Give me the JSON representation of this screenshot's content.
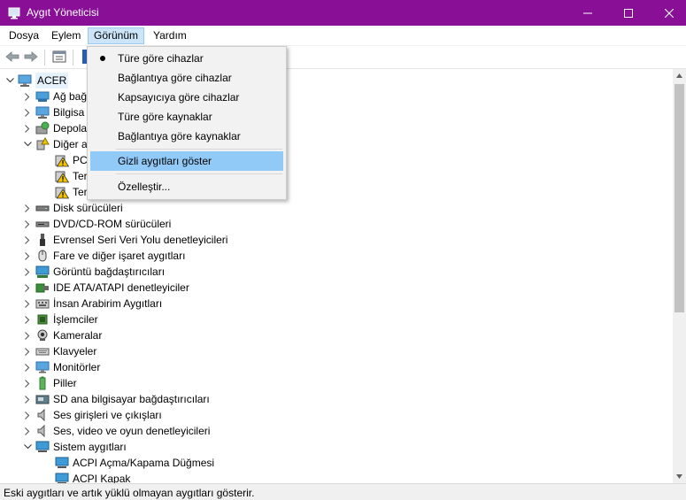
{
  "window": {
    "title": "Aygıt Yöneticisi"
  },
  "menubar": [
    "Dosya",
    "Eylem",
    "Görünüm",
    "Yardım"
  ],
  "view_menu": {
    "items": [
      {
        "label": "Türe göre cihazlar",
        "selected": true
      },
      {
        "label": "Bağlantıya göre cihazlar"
      },
      {
        "label": "Kapsayıcıya göre cihazlar"
      },
      {
        "label": "Türe göre kaynaklar"
      },
      {
        "label": "Bağlantıya göre kaynaklar"
      },
      {
        "label": "Gizli aygıtları göster",
        "highlighted": true
      },
      {
        "label": "Özelleştir..."
      }
    ]
  },
  "tree": {
    "root": "ACER",
    "nodes": [
      {
        "label": "Ağ bağ",
        "icon": "network-adapter-icon",
        "expanded": false
      },
      {
        "label": "Bilgisa",
        "icon": "computer-icon",
        "expanded": false
      },
      {
        "label": "Depola",
        "icon": "storage-controller-icon",
        "expanded": false
      },
      {
        "label": "Diğer a",
        "icon": "other-devices-icon",
        "expanded": true
      },
      {
        "label": "PC",
        "icon": "warning-device-icon",
        "child": true
      },
      {
        "label": "Ter",
        "icon": "warning-device-icon",
        "child": true
      },
      {
        "label": "Ter",
        "icon": "warning-device-icon",
        "child": true
      },
      {
        "label": "Disk sürücüleri",
        "icon": "disk-drive-icon",
        "expanded": false
      },
      {
        "label": "DVD/CD-ROM sürücüleri",
        "icon": "dvd-drive-icon",
        "expanded": false
      },
      {
        "label": "Evrensel Seri Veri Yolu denetleyicileri",
        "icon": "usb-icon",
        "expanded": false
      },
      {
        "label": "Fare ve diğer işaret aygıtları",
        "icon": "mouse-icon",
        "expanded": false
      },
      {
        "label": "Görüntü bağdaştırıcıları",
        "icon": "display-adapter-icon",
        "expanded": false
      },
      {
        "label": "IDE ATA/ATAPI denetleyiciler",
        "icon": "ide-controller-icon",
        "expanded": false
      },
      {
        "label": "İnsan Arabirim Aygıtları",
        "icon": "hid-icon",
        "expanded": false
      },
      {
        "label": "İşlemciler",
        "icon": "processor-icon",
        "expanded": false
      },
      {
        "label": "Kameralar",
        "icon": "camera-icon",
        "expanded": false
      },
      {
        "label": "Klavyeler",
        "icon": "keyboard-icon",
        "expanded": false
      },
      {
        "label": "Monitörler",
        "icon": "monitor-icon",
        "expanded": false
      },
      {
        "label": "Piller",
        "icon": "battery-icon",
        "expanded": false
      },
      {
        "label": "SD ana bilgisayar bağdaştırıcıları",
        "icon": "sd-host-icon",
        "expanded": false
      },
      {
        "label": "Ses girişleri ve çıkışları",
        "icon": "speaker-icon",
        "expanded": false
      },
      {
        "label": "Ses, video ve oyun denetleyicileri",
        "icon": "speaker-icon",
        "expanded": false
      },
      {
        "label": "Sistem aygıtları",
        "icon": "system-devices-icon",
        "expanded": true
      },
      {
        "label": "ACPI Açma/Kapama Düğmesi",
        "icon": "system-device-icon",
        "child": true
      },
      {
        "label": "ACPI Kapak",
        "icon": "system-device-icon",
        "child": true
      }
    ]
  },
  "status": "Eski aygıtları ve artık yüklü olmayan aygıtları gösterir.",
  "colors": {
    "titlebar": "#880f96",
    "menu_highlight": "#91c9f7",
    "warning": "#f5c400"
  }
}
